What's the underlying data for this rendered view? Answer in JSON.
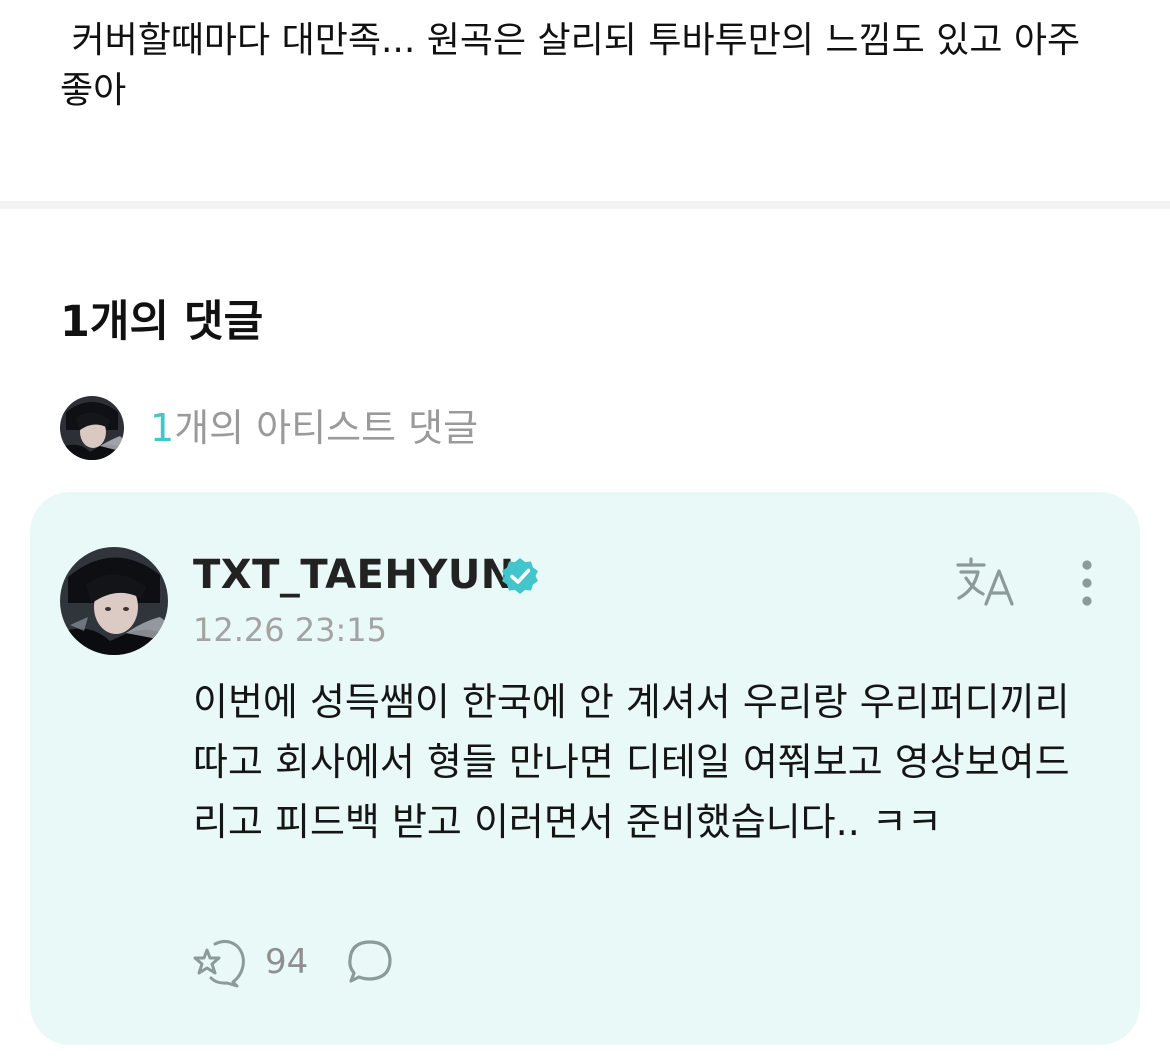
{
  "post": {
    "text": " 커버할때마다 대만족... 원곡은 살리되 투바투만의 느낌도 있고 아주 좋아"
  },
  "comments_section": {
    "title": "1개의 댓글",
    "artist_row": {
      "count": "1",
      "label": "개의 아티스트 댓글"
    }
  },
  "comment": {
    "username": "TXT_TAEHYUN",
    "verified": true,
    "timestamp": "12.26 23:15",
    "body": "이번에 성득쌤이 한국에 안 계셔서 우리랑 우리퍼디끼리 따고 회사에서 형들 만나면 디테일 여쭤보고 영상보여드리고 피드백 받고 이러면서 준비했습니다.. ㅋㅋ",
    "like_count": "94",
    "icons": {
      "translate": "translate-icon",
      "more": "more-vertical-icon",
      "like": "like-icon",
      "reply": "reply-bubble-icon",
      "verified": "verified-badge-icon"
    }
  },
  "colors": {
    "accent": "#43c5cc",
    "card_background": "#e9f9f7",
    "muted_text": "#9a9a9a",
    "icon_gray": "#8c9a98"
  }
}
